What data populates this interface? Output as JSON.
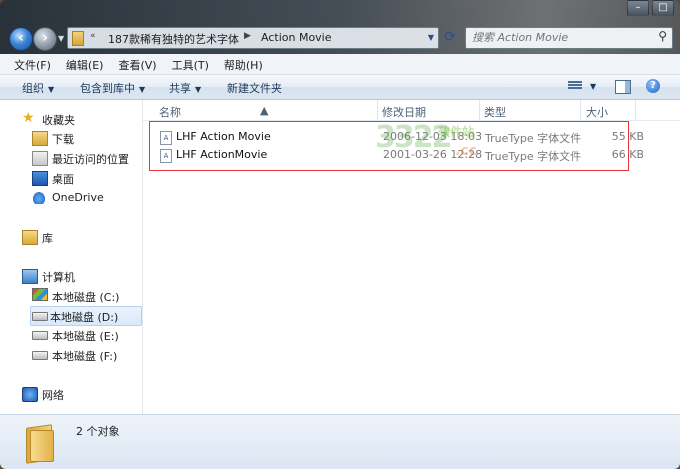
{
  "address": {
    "crumbs": [
      "187款稀有独特的艺术字体",
      "Action Movie"
    ]
  },
  "search": {
    "placeholder": "搜索 Action Movie"
  },
  "menu": [
    "文件(F)",
    "编辑(E)",
    "查看(V)",
    "工具(T)",
    "帮助(H)"
  ],
  "toolbar": {
    "organize": "组织",
    "include": "包含到库中",
    "share": "共享",
    "new_folder": "新建文件夹"
  },
  "nav": {
    "favorites": "收藏夹",
    "downloads": "下载",
    "recent": "最近访问的位置",
    "desktop": "桌面",
    "onedrive": "OneDrive",
    "libraries": "库",
    "computer": "计算机",
    "drives": [
      "本地磁盘 (C:)",
      "本地磁盘 (D:)",
      "本地磁盘 (E:)",
      "本地磁盘 (F:)"
    ],
    "network": "网络"
  },
  "columns": {
    "name": "名称",
    "date": "修改日期",
    "type": "类型",
    "size": "大小"
  },
  "files": [
    {
      "name": "LHF Action Movie",
      "date": "2006-12-03 18:03",
      "type": "TrueType 字体文件",
      "size": "55 KB"
    },
    {
      "name": "LHF ActionMovie",
      "date": "2001-03-26 12:28",
      "type": "TrueType 字体文件",
      "size": "66 KB"
    }
  ],
  "watermark": {
    "main": "3322",
    "sub": "软件站",
    "cc": ".cc"
  },
  "status": {
    "count": "2 个对象"
  },
  "colors": {
    "highlight_border": "#e8363b",
    "toolbar_text": "#1e395b"
  }
}
